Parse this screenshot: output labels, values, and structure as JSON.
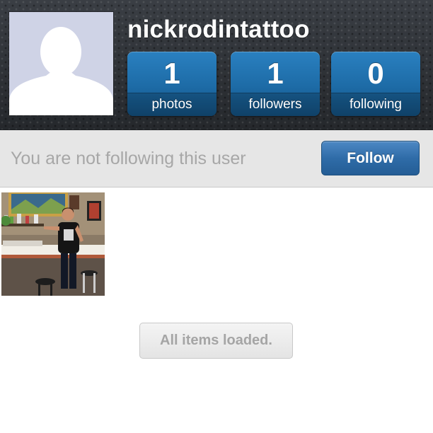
{
  "profile": {
    "username": "nickrodintattoo",
    "avatar_icon": "default-user-silhouette-icon"
  },
  "stats": [
    {
      "count": "1",
      "label": "photos"
    },
    {
      "count": "1",
      "label": "followers"
    },
    {
      "count": "0",
      "label": "following"
    }
  ],
  "follow": {
    "status_text": "You are not following this user",
    "button_label": "Follow"
  },
  "photos": [
    {
      "description_icon": "photo-thumbnail"
    }
  ],
  "feed": {
    "load_status": "All items loaded."
  },
  "colors": {
    "header_bg": "#2f3338",
    "stat_blue": "#1d6ba6",
    "follow_button_blue": "#2f6ca8",
    "follow_bar_bg": "#e6e6e6",
    "muted_text": "#a7a7a7",
    "avatar_bg": "#cfd3e6"
  }
}
